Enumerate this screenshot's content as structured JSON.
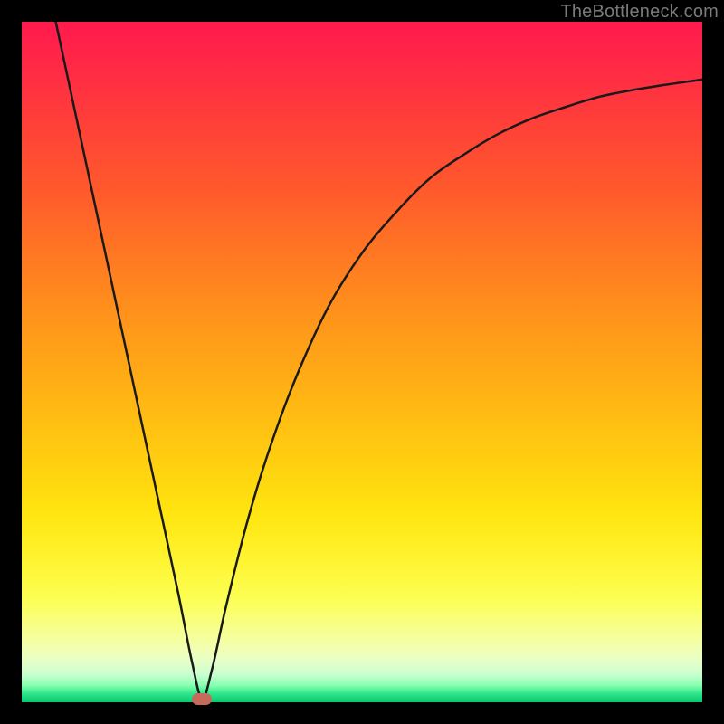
{
  "watermark": "TheBottleneck.com",
  "colors": {
    "curve_stroke": "#1a1a1a",
    "marker_fill": "#c86a5a",
    "frame_bg": "#000000"
  },
  "chart_data": {
    "type": "line",
    "title": "",
    "xlabel": "",
    "ylabel": "",
    "xlim": [
      0,
      100
    ],
    "ylim": [
      0,
      100
    ],
    "x": [
      5,
      8,
      11,
      14,
      17,
      20,
      23,
      25,
      26.5,
      28,
      30,
      33,
      36,
      40,
      45,
      50,
      55,
      60,
      65,
      70,
      75,
      80,
      85,
      90,
      95,
      100
    ],
    "values": [
      100,
      86,
      72,
      58,
      44,
      30,
      16,
      6,
      0.5,
      5,
      14,
      26,
      36,
      47,
      58,
      66,
      72,
      77,
      80.5,
      83.5,
      85.8,
      87.5,
      89,
      90,
      90.8,
      91.5
    ],
    "marker": {
      "x": 26.5,
      "y": 0.5
    },
    "annotations": []
  }
}
